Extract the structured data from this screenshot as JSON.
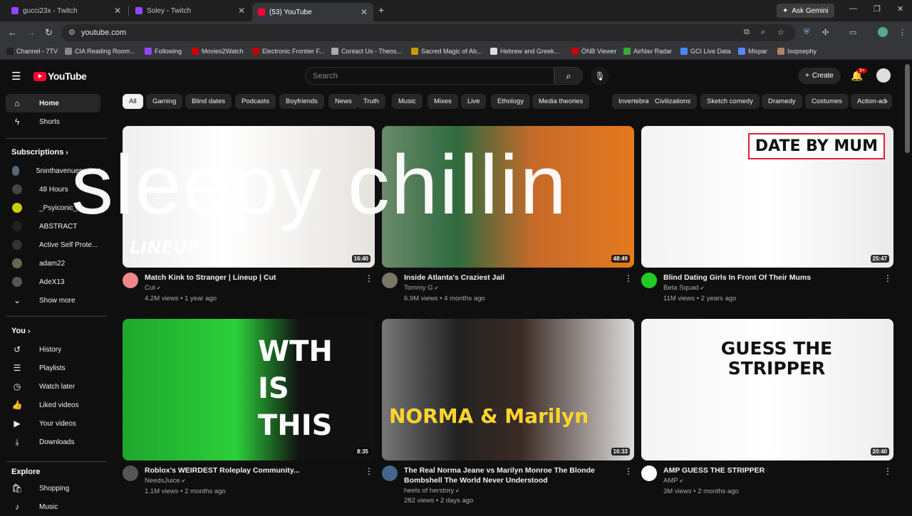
{
  "browser": {
    "tabs": [
      {
        "title": "gucci23x - Twitch",
        "icon": "twitch-icon",
        "color": "#9146ff"
      },
      {
        "title": "Soley - Twitch",
        "icon": "twitch-icon",
        "color": "#9146ff"
      },
      {
        "title": "(53) YouTube",
        "icon": "youtube-icon",
        "color": "#ff0033"
      }
    ],
    "gemini_label": "Ask Gemini",
    "url": "youtube.com",
    "bookmarks": [
      {
        "label": "Channel - 7TV",
        "color": "#222"
      },
      {
        "label": "CIA Reading Room...",
        "color": "#888"
      },
      {
        "label": "Following",
        "color": "#9146ff"
      },
      {
        "label": "Movies2Watch",
        "color": "#c00"
      },
      {
        "label": "Electronic Frontier F...",
        "color": "#b00"
      },
      {
        "label": "Contact Us - Theos...",
        "color": "#aaa"
      },
      {
        "label": "Sacred Magic of Ab...",
        "color": "#c90"
      },
      {
        "label": "Hebrew and Greek...",
        "color": "#ddd"
      },
      {
        "label": "ÖNB Viewer",
        "color": "#c00"
      },
      {
        "label": "AirNav Radar",
        "color": "#3a3"
      },
      {
        "label": "GCI Live Data",
        "color": "#48f"
      },
      {
        "label": "Mispar",
        "color": "#58f"
      },
      {
        "label": "Isopsephy",
        "color": "#a86"
      }
    ]
  },
  "header": {
    "logo": "YouTube",
    "search_placeholder": "Search",
    "create_label": "Create",
    "notif_count": "9+"
  },
  "sidebar": {
    "home": "Home",
    "shorts": "Shorts",
    "subscriptions_title": "Subscriptions",
    "subscriptions": [
      {
        "name": "5ninthavenueproject",
        "color": "#567"
      },
      {
        "name": "48 Hours",
        "color": "#444"
      },
      {
        "name": "_Psyiconic_",
        "color": "#cc0"
      },
      {
        "name": "ABSTRACT",
        "color": "#222"
      },
      {
        "name": "Active Self Prote...",
        "color": "#333"
      },
      {
        "name": "adam22",
        "color": "#665"
      },
      {
        "name": "AdeX13",
        "color": "#555"
      }
    ],
    "show_more": "Show more",
    "you_title": "You",
    "you_items": [
      "History",
      "Playlists",
      "Watch later",
      "Liked videos",
      "Your videos",
      "Downloads"
    ],
    "explore_title": "Explore",
    "explore_items": [
      "Shopping",
      "Music"
    ]
  },
  "chips": [
    "All",
    "Gaming",
    "Blind dates",
    "Podcasts",
    "Boyfriends",
    "News",
    "Truth",
    "Music",
    "Mixes",
    "Live",
    "Ethology",
    "Media theories",
    "Invertebrates",
    "Civilizations",
    "Sketch comedy",
    "Dramedy",
    "Costumes",
    "Action-ad"
  ],
  "videos": [
    {
      "title": "Match Kink to Stranger | Lineup | Cut",
      "channel": "Cut",
      "meta": "4.2M views • 1 year ago",
      "duration": "16:40",
      "thumb_text": "LINEUP",
      "avatar": "#e88"
    },
    {
      "title": "Inside Atlanta's Craziest Jail",
      "channel": "Tommy G",
      "meta": "6.9M views • 4 months ago",
      "duration": "48:49",
      "thumb_text": "",
      "avatar": "#776"
    },
    {
      "title": "Blind Dating Girls In Front Of Their Mums",
      "channel": "Beta Squad",
      "meta": "11M views • 2 years ago",
      "duration": "25:47",
      "thumb_text": "DATE BY MUM",
      "avatar": "#2c2"
    },
    {
      "title": "Roblox's WEIRDEST Roleplay Community...",
      "channel": "NeedsJuice",
      "meta": "1.1M views • 2 months ago",
      "duration": "8:35",
      "thumb_text": "WTH IS THIS",
      "avatar": "#555"
    },
    {
      "title": "The Real Norma Jeane vs Marilyn Monroe The Blonde Bombshell The World Never Understood",
      "channel": "heels of herstory",
      "meta": "282 views • 2 days ago",
      "duration": "16:33",
      "thumb_text": "NORMA & Marilyn",
      "avatar": "#468"
    },
    {
      "title": "AMP GUESS THE STRIPPER",
      "channel": "AMP",
      "meta": "3M views • 2 months ago",
      "duration": "20:40",
      "thumb_text": "GUESS THE STRIPPER",
      "avatar": "#fff"
    }
  ],
  "overlay": "sleepy chillin"
}
